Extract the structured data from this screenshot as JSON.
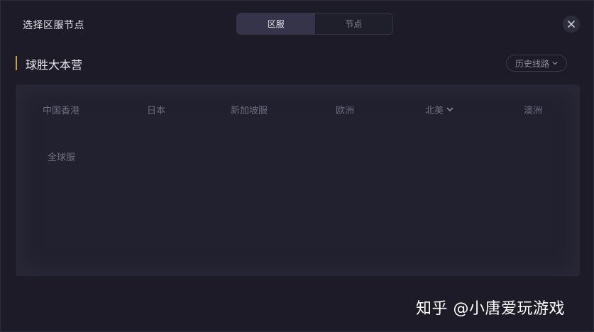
{
  "dialog": {
    "title": "选择区服节点",
    "tabs": [
      {
        "label": "区服",
        "active": true
      },
      {
        "label": "节点",
        "active": false
      }
    ],
    "close_icon": "close-icon"
  },
  "section": {
    "title": "球胜大本营",
    "accent_color": "#c9a04a",
    "history_label": "历史线路"
  },
  "regions": [
    {
      "label": "中国香港"
    },
    {
      "label": "日本"
    },
    {
      "label": "新加坡服"
    },
    {
      "label": "欧洲"
    },
    {
      "label": "北美",
      "has_dropdown": true
    },
    {
      "label": "澳洲"
    },
    {
      "label": "全球服"
    }
  ],
  "watermark": {
    "text": "知乎 @小唐爱玩游戏"
  }
}
